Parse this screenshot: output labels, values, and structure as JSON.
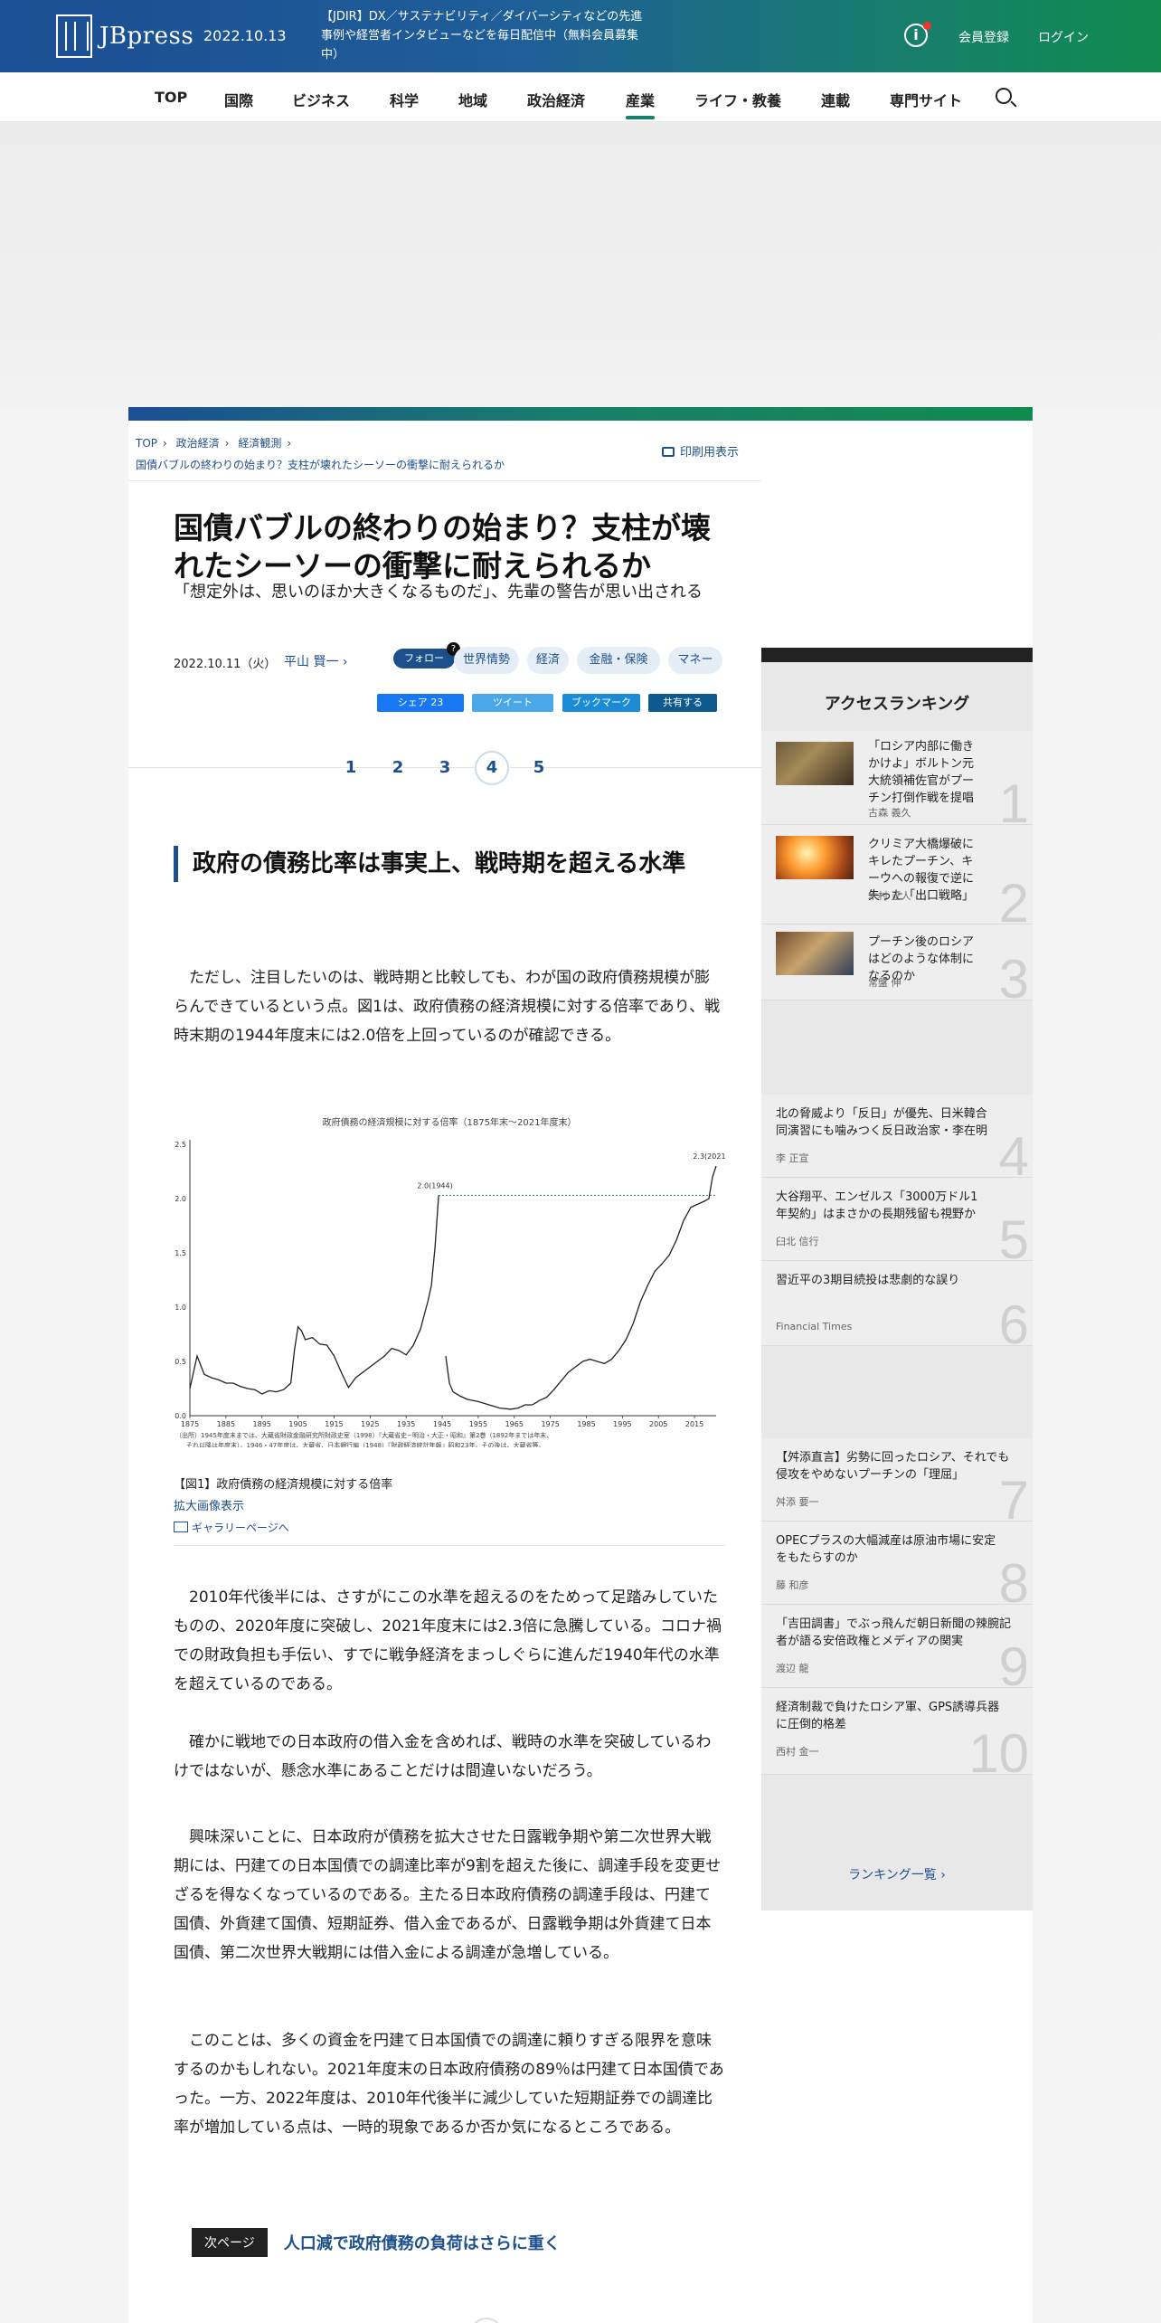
{
  "header": {
    "logo": "JBpress",
    "date": "2022.10.13",
    "notice": "【JDIR】DX／サステナビリティ／ダイバーシティなどの先進事例や経営者インタビューなどを毎日配信中（無料会員募集中）",
    "register": "会員登録",
    "login": "ログイン"
  },
  "nav": [
    "TOP",
    "国際",
    "ビジネス",
    "科学",
    "地域",
    "政治経済",
    "産業",
    "ライフ・教養",
    "連載",
    "専門サイト"
  ],
  "nav_active": "産業",
  "breadcrumb": {
    "items": [
      "TOP",
      "政治経済",
      "経済観測"
    ],
    "current": "国債バブルの終わりの始まり？支柱が壊れたシーソーの衝撃に耐えられるか",
    "print": "印刷用表示"
  },
  "article": {
    "title": "国債バブルの終わりの始まり？支柱が壊れたシーソーの衝撃に耐えられるか",
    "subtitle": "「想定外は、思いのほか大きくなるものだ」、先輩の警告が思い出される",
    "date": "2022.10.11（火）",
    "author": "平山 賢一",
    "follow": "フォロー",
    "tags": [
      "世界情勢",
      "経済",
      "金融・保険",
      "マネー"
    ],
    "share": {
      "facebook": "シェア 23",
      "twitter": "ツイート",
      "hatena": "ブックマーク",
      "linkedin": "共有する"
    },
    "pages": [
      "1",
      "2",
      "3",
      "4",
      "5"
    ],
    "current_page": "4",
    "heading": "政府の債務比率は事実上、戦時期を超える水準",
    "paragraphs": [
      "ただし、注目したいのは、戦時期と比較しても、わが国の政府債務規模が膨らんできているという点。図1は、政府債務の経済規模に対する倍率であり、戦時末期の1944年度末には2.0倍を上回っているのが確認できる。",
      "2010年代後半には、さすがにこの水準を超えるのをためって足踏みしていたものの、2020年度に突破し、2021年度末には2.3倍に急騰している。コロナ禍での財政負担も手伝い、すでに戦争経済をまっしぐらに進んだ1940年代の水準を超えているのである。",
      "確かに戦地での日本政府の借入金を含めれば、戦時の水準を突破しているわけではないが、懸念水準にあることだけは間違いないだろう。",
      "興味深いことに、日本政府が債務を拡大させた日露戦争期や第二次世界大戦期には、円建ての日本国債での調達比率が9割を超えた後に、調達手段を変更せざるを得なくなっているのである。主たる日本政府債務の調達手段は、円建て国債、外貨建て国債、短期証券、借入金であるが、日露戦争期は外貨建て日本国債、第二次世界大戦期には借入金による調達が急増している。",
      "このことは、多くの資金を円建て日本国債での調達に頼りすぎる限界を意味するのかもしれない。2021年度末の日本政府債務の89％は円建て日本国債であった。一方、2022年度は、2010年代後半に減少していた短期証券での調達比率が増加している点は、一時的現象であるか否か気になるところである。"
    ],
    "figure_caption": "【図1】政府債務の経済規模に対する倍率",
    "enlarge": "拡大画像表示",
    "gallery": "ギャラリーページへ",
    "next_label": "次ページ",
    "next_title": "人口減で政府債務の負荷はさらに重く"
  },
  "chart_data": {
    "type": "line",
    "title": "政府債務の経済規模に対する倍率（1875年末〜2021年度末）",
    "xlim": [
      1875,
      2021
    ],
    "ylim": [
      0,
      2.5
    ],
    "yticks": [
      "0.0",
      "0.5",
      "1.0",
      "1.5",
      "2.0",
      "2.5"
    ],
    "xticks": [
      "1875",
      "1885",
      "1895",
      "1905",
      "1915",
      "1925",
      "1935",
      "1945",
      "1955",
      "1965",
      "1975",
      "1985",
      "1995",
      "2005",
      "2015"
    ],
    "annotations": [
      "2.0(1944)",
      "2.3(2021)"
    ],
    "source_line1": "（出所）1945年度末までは、大蔵省財政金融研究所財政史室（1998）『大蔵省史−明治・大正・昭和』第2巻（1892年までは年末、",
    "source_line2": "それ以降は年度末）。1946・47年度は、大蔵省、日本銀行編（1948）『財政経済統計年報』昭和23年。その後は、大蔵省等。",
    "series": [
      {
        "x": [
          1875,
          1877,
          1879,
          1881,
          1883,
          1885,
          1887,
          1889,
          1891,
          1893,
          1895,
          1897,
          1899,
          1901,
          1903,
          1904,
          1905,
          1906,
          1907,
          1909,
          1911,
          1913,
          1915,
          1917,
          1919,
          1921,
          1923,
          1925,
          1927,
          1929,
          1931,
          1933,
          1935,
          1937,
          1939,
          1941,
          1942,
          1943,
          1944
        ],
        "y": [
          0.25,
          0.55,
          0.38,
          0.35,
          0.33,
          0.3,
          0.3,
          0.27,
          0.25,
          0.24,
          0.2,
          0.23,
          0.22,
          0.24,
          0.3,
          0.6,
          0.82,
          0.78,
          0.7,
          0.72,
          0.66,
          0.65,
          0.55,
          0.4,
          0.26,
          0.35,
          0.4,
          0.45,
          0.5,
          0.55,
          0.62,
          0.6,
          0.56,
          0.65,
          0.8,
          1.05,
          1.2,
          1.55,
          2.03
        ]
      },
      {
        "x": [
          1946,
          1947,
          1948,
          1950,
          1952,
          1955,
          1958,
          1961,
          1964,
          1966,
          1968,
          1970,
          1972,
          1974,
          1976,
          1978,
          1980,
          1982,
          1984,
          1986,
          1988,
          1990,
          1992,
          1994,
          1996,
          1998,
          2000,
          2002,
          2004,
          2006,
          2008,
          2010,
          2012,
          2014,
          2016,
          2018,
          2019,
          2020,
          2021
        ],
        "y": [
          0.55,
          0.3,
          0.22,
          0.18,
          0.15,
          0.13,
          0.1,
          0.07,
          0.06,
          0.07,
          0.1,
          0.1,
          0.14,
          0.17,
          0.24,
          0.32,
          0.4,
          0.45,
          0.5,
          0.52,
          0.5,
          0.48,
          0.52,
          0.6,
          0.7,
          0.85,
          1.05,
          1.2,
          1.33,
          1.4,
          1.48,
          1.62,
          1.8,
          1.92,
          1.95,
          1.98,
          2.0,
          2.2,
          2.3
        ]
      }
    ],
    "reference_line": 2.03
  },
  "sidebar": {
    "ranking_title": "アクセスランキング",
    "items": [
      {
        "rank": "1",
        "title": "「ロシア内部に働きかけよ」ボルトン元大統領補佐官がプーチン打倒作戦を提唱",
        "author": "古森 義久"
      },
      {
        "rank": "2",
        "title": "クリミア大橋爆破にキレたプーチン、キーウへの報復で逆に失った「出口戦略」",
        "author": "木村 正人"
      },
      {
        "rank": "3",
        "title": "プーチン後のロシアはどのような体制になるのか",
        "author": "常盤 伸"
      },
      {
        "rank": "4",
        "title": "北の脅威より「反日」が優先、日米韓合同演習にも噛みつく反日政治家・李在明",
        "author": "李 正宣"
      },
      {
        "rank": "5",
        "title": "大谷翔平、エンゼルス「3000万ドル1年契約」はまさかの長期残留も視野か",
        "author": "臼北 信行"
      },
      {
        "rank": "6",
        "title": "習近平の3期目続投は悲劇的な誤り",
        "author": "Financial Times"
      },
      {
        "rank": "7",
        "title": "【舛添直言】劣勢に回ったロシア、それでも侵攻をやめないプーチンの「理屈」",
        "author": "舛添 要一"
      },
      {
        "rank": "8",
        "title": "OPECプラスの大幅減産は原油市場に安定をもたらすのか",
        "author": "藤 和彦"
      },
      {
        "rank": "9",
        "title": "「吉田調書」でぶっ飛んだ朝日新聞の辣腕記者が語る安倍政権とメディアの関実",
        "author": "渡辺 龍"
      },
      {
        "rank": "10",
        "title": "経済制裁で負けたロシア軍、GPS誘導兵器に圧倒的格差",
        "author": "西村 金一"
      }
    ],
    "more": "ランキング一覧 ›"
  }
}
